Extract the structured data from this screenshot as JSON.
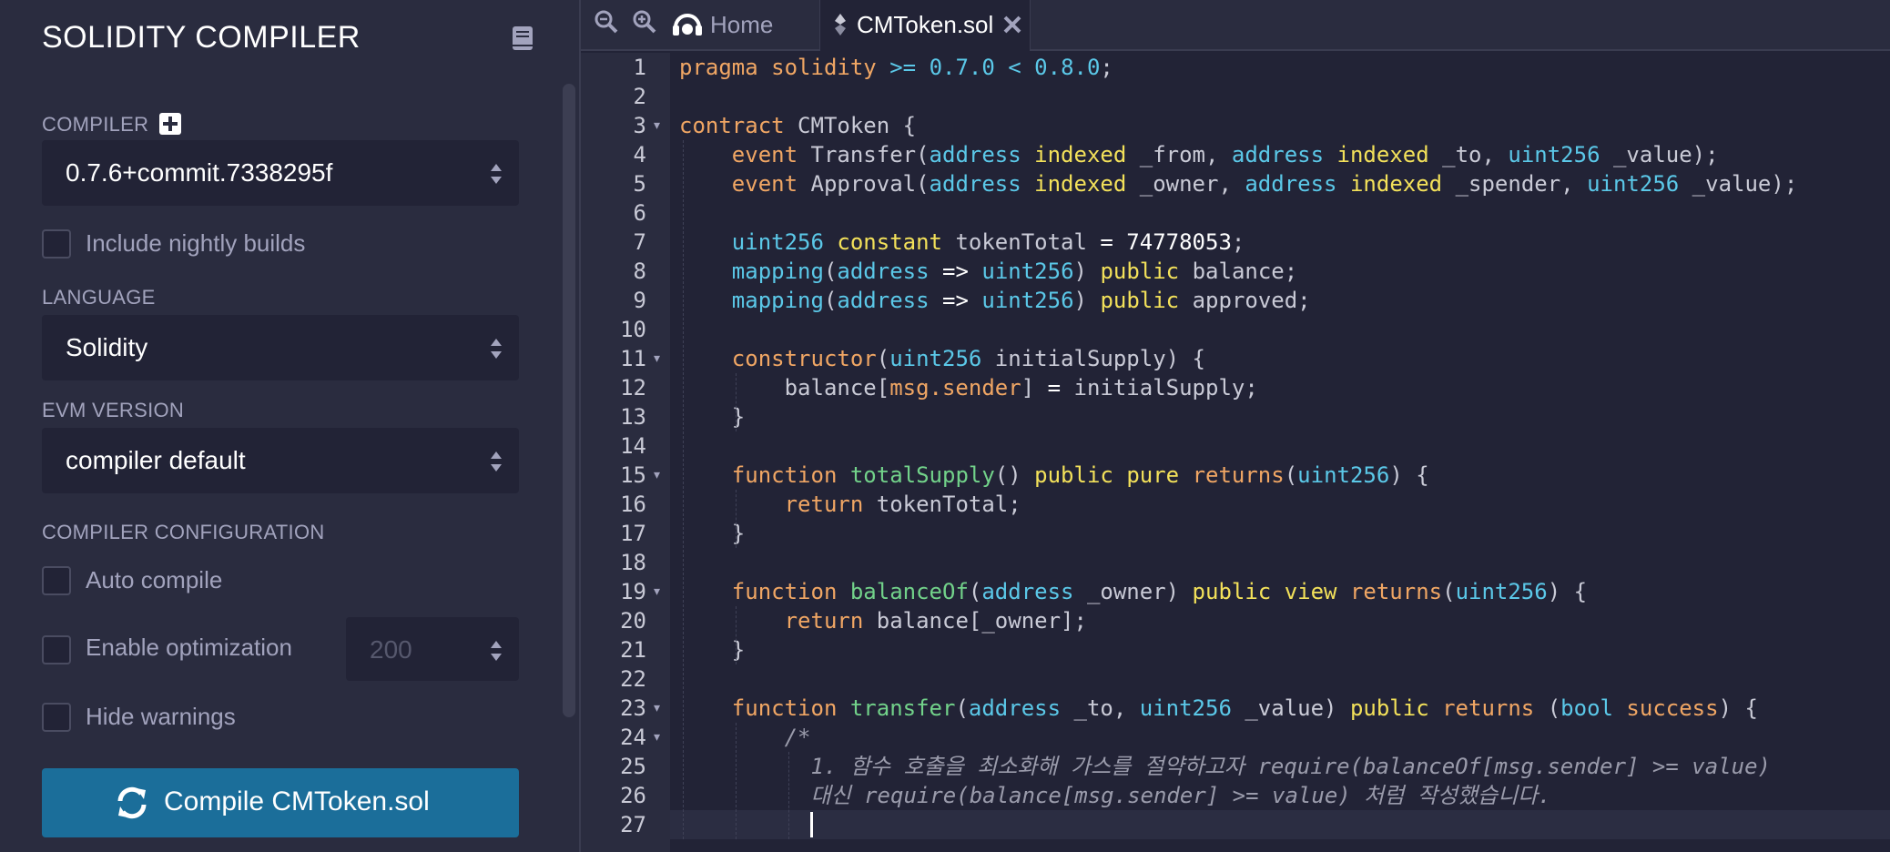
{
  "panel": {
    "title": "SOLIDITY COMPILER",
    "compiler_label": "COMPILER",
    "compiler_version": "0.7.6+commit.7338295f",
    "nightly_label": "Include nightly builds",
    "language_label": "LANGUAGE",
    "language_value": "Solidity",
    "evm_label": "EVM VERSION",
    "evm_value": "compiler default",
    "config_label": "COMPILER CONFIGURATION",
    "auto_compile_label": "Auto compile",
    "optimization_label": "Enable optimization",
    "optimization_runs": "200",
    "hide_warnings_label": "Hide warnings",
    "compile_button": "Compile CMToken.sol"
  },
  "tabs": {
    "home_label": "Home",
    "file_label": "CMToken.sol"
  },
  "editor": {
    "line_numbers": [
      "1",
      "2",
      "3",
      "4",
      "5",
      "6",
      "7",
      "8",
      "9",
      "10",
      "11",
      "12",
      "13",
      "14",
      "15",
      "16",
      "17",
      "18",
      "19",
      "20",
      "21",
      "22",
      "23",
      "24",
      "25",
      "26",
      "27"
    ],
    "fold_lines": [
      3,
      11,
      15,
      19,
      23,
      24
    ],
    "code_lines": [
      "pragma solidity >= 0.7.0 < 0.8.0;",
      "",
      "contract CMToken {",
      "    event Transfer(address indexed _from, address indexed _to, uint256 _value);",
      "    event Approval(address indexed _owner, address indexed _spender, uint256 _value);",
      "",
      "    uint256 constant tokenTotal = 74778053;",
      "    mapping(address => uint256) public balance;",
      "    mapping(address => uint256) public approved;",
      "",
      "    constructor(uint256 initialSupply) {",
      "        balance[msg.sender] = initialSupply;",
      "    }",
      "",
      "    function totalSupply() public pure returns(uint256) {",
      "        return tokenTotal;",
      "    }",
      "",
      "    function balanceOf(address _owner) public view returns(uint256) {",
      "        return balance[_owner];",
      "    }",
      "",
      "    function transfer(address _to, uint256 _value) public returns (bool success) {",
      "        /*",
      "          1. 함수 호출을 최소화해 가스를 절약하고자 require(balanceOf[msg.sender] >= value)",
      "          대신 require(balance[msg.sender] >= value) 처럼 작성했습니다.",
      "          "
    ]
  },
  "colors": {
    "accent_button": "#1b6e9a",
    "keyword": "#f0a664",
    "type": "#5bc8e8",
    "modifier": "#f3e15a",
    "function_name": "#72d28a"
  },
  "icons": {
    "panel_doc": "book-icon",
    "compiler_add": "plus-square-icon",
    "zoom_out": "zoom-out-icon",
    "zoom_in": "zoom-in-icon",
    "home": "remix-logo-icon",
    "file": "solidity-file-icon",
    "close": "close-icon",
    "compile": "refresh-icon"
  }
}
